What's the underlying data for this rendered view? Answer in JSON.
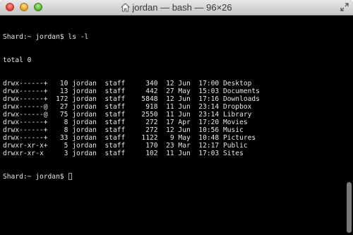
{
  "window": {
    "title": "jordan — bash — 96×26",
    "icon": "home-folder-icon"
  },
  "terminal": {
    "prompt_command": "Shard:~ jordan$ ls -l",
    "total": "total 0",
    "entries": [
      {
        "perms": "drwx------+",
        "links": "10",
        "owner": "jordan",
        "group": "staff",
        "size": "340",
        "day": "12",
        "month": "Jun",
        "time": "17:00",
        "name": "Desktop"
      },
      {
        "perms": "drwx------+",
        "links": "13",
        "owner": "jordan",
        "group": "staff",
        "size": "442",
        "day": "27",
        "month": "May",
        "time": "15:03",
        "name": "Documents"
      },
      {
        "perms": "drwx------+",
        "links": "172",
        "owner": "jordan",
        "group": "staff",
        "size": "5848",
        "day": "12",
        "month": "Jun",
        "time": "17:16",
        "name": "Downloads"
      },
      {
        "perms": "drwx------@",
        "links": "27",
        "owner": "jordan",
        "group": "staff",
        "size": "918",
        "day": "11",
        "month": "Jun",
        "time": "23:14",
        "name": "Dropbox"
      },
      {
        "perms": "drwx------@",
        "links": "75",
        "owner": "jordan",
        "group": "staff",
        "size": "2550",
        "day": "11",
        "month": "Jun",
        "time": "23:14",
        "name": "Library"
      },
      {
        "perms": "drwx------+",
        "links": "8",
        "owner": "jordan",
        "group": "staff",
        "size": "272",
        "day": "17",
        "month": "Apr",
        "time": "17:20",
        "name": "Movies"
      },
      {
        "perms": "drwx------+",
        "links": "8",
        "owner": "jordan",
        "group": "staff",
        "size": "272",
        "day": "12",
        "month": "Jun",
        "time": "10:56",
        "name": "Music"
      },
      {
        "perms": "drwx------+",
        "links": "33",
        "owner": "jordan",
        "group": "staff",
        "size": "1122",
        "day": "9",
        "month": "May",
        "time": "10:48",
        "name": "Pictures"
      },
      {
        "perms": "drwxr-xr-x+",
        "links": "5",
        "owner": "jordan",
        "group": "staff",
        "size": "170",
        "day": "23",
        "month": "Mar",
        "time": "12:17",
        "name": "Public"
      },
      {
        "perms": "drwxr-xr-x",
        "links": "3",
        "owner": "jordan",
        "group": "staff",
        "size": "102",
        "day": "11",
        "month": "Jun",
        "time": "17:03",
        "name": "Sites"
      }
    ],
    "prompt": "Shard:~ jordan$ "
  },
  "colors": {
    "background": "#000000",
    "text": "#e8e8e8",
    "titlebar_top": "#e8e8e8",
    "titlebar_bottom": "#c6c6c6",
    "close": "#e2463a",
    "minimize": "#e6a62a",
    "zoom": "#58b82f"
  }
}
